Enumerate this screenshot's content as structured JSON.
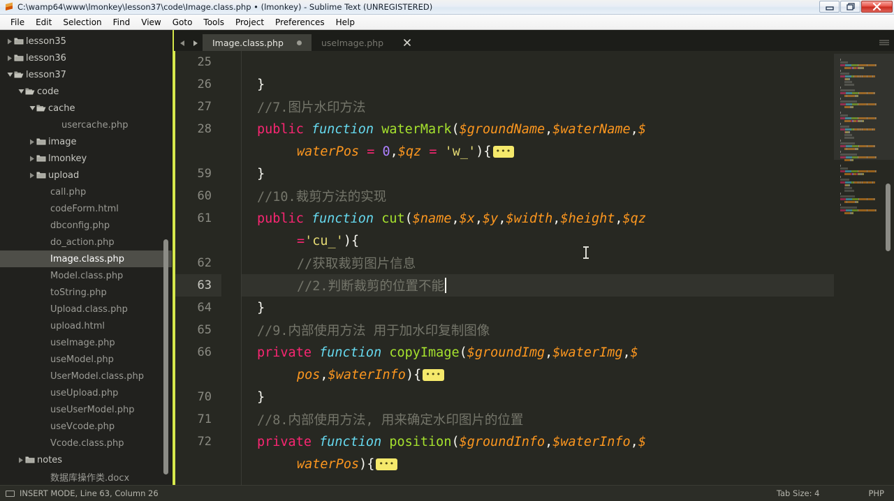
{
  "window": {
    "title": "C:\\wamp64\\www\\lmonkey\\lesson37\\code\\Image.class.php • (lmonkey) - Sublime Text (UNREGISTERED)",
    "icon": "sublime-text-logo-icon",
    "controls": {
      "minimize": "minimize-icon",
      "restore": "restore-icon",
      "close": "close-icon"
    }
  },
  "menubar": {
    "items": [
      {
        "label": "File"
      },
      {
        "label": "Edit"
      },
      {
        "label": "Selection"
      },
      {
        "label": "Find"
      },
      {
        "label": "View"
      },
      {
        "label": "Goto"
      },
      {
        "label": "Tools"
      },
      {
        "label": "Project"
      },
      {
        "label": "Preferences"
      },
      {
        "label": "Help"
      }
    ]
  },
  "sidebar": {
    "items": [
      {
        "label": "lesson35",
        "indent": 1,
        "type": "folder",
        "state": "collapsed",
        "selected": false
      },
      {
        "label": "lesson36",
        "indent": 1,
        "type": "folder",
        "state": "collapsed",
        "selected": false
      },
      {
        "label": "lesson37",
        "indent": 1,
        "type": "folder",
        "state": "expanded",
        "selected": false
      },
      {
        "label": "code",
        "indent": 2,
        "type": "folder",
        "state": "expanded",
        "selected": false
      },
      {
        "label": "cache",
        "indent": 3,
        "type": "folder",
        "state": "expanded",
        "selected": false
      },
      {
        "label": "usercache.php",
        "indent": 5,
        "type": "file",
        "state": "none",
        "selected": false
      },
      {
        "label": "image",
        "indent": 3,
        "type": "folder",
        "state": "collapsed",
        "selected": false
      },
      {
        "label": "lmonkey",
        "indent": 3,
        "type": "folder",
        "state": "collapsed",
        "selected": false
      },
      {
        "label": "upload",
        "indent": 3,
        "type": "folder",
        "state": "collapsed",
        "selected": false
      },
      {
        "label": "call.php",
        "indent": 4,
        "type": "file",
        "state": "none",
        "selected": false
      },
      {
        "label": "codeForm.html",
        "indent": 4,
        "type": "file",
        "state": "none",
        "selected": false
      },
      {
        "label": "dbconfig.php",
        "indent": 4,
        "type": "file",
        "state": "none",
        "selected": false
      },
      {
        "label": "do_action.php",
        "indent": 4,
        "type": "file",
        "state": "none",
        "selected": false
      },
      {
        "label": "Image.class.php",
        "indent": 4,
        "type": "file",
        "state": "none",
        "selected": true
      },
      {
        "label": "Model.class.php",
        "indent": 4,
        "type": "file",
        "state": "none",
        "selected": false
      },
      {
        "label": "toString.php",
        "indent": 4,
        "type": "file",
        "state": "none",
        "selected": false
      },
      {
        "label": "Upload.class.php",
        "indent": 4,
        "type": "file",
        "state": "none",
        "selected": false
      },
      {
        "label": "upload.html",
        "indent": 4,
        "type": "file",
        "state": "none",
        "selected": false
      },
      {
        "label": "useImage.php",
        "indent": 4,
        "type": "file",
        "state": "none",
        "selected": false
      },
      {
        "label": "useModel.php",
        "indent": 4,
        "type": "file",
        "state": "none",
        "selected": false
      },
      {
        "label": "UserModel.class.php",
        "indent": 4,
        "type": "file",
        "state": "none",
        "selected": false
      },
      {
        "label": "useUpload.php",
        "indent": 4,
        "type": "file",
        "state": "none",
        "selected": false
      },
      {
        "label": "useUserModel.php",
        "indent": 4,
        "type": "file",
        "state": "none",
        "selected": false
      },
      {
        "label": "useVcode.php",
        "indent": 4,
        "type": "file",
        "state": "none",
        "selected": false
      },
      {
        "label": "Vcode.class.php",
        "indent": 4,
        "type": "file",
        "state": "none",
        "selected": false
      },
      {
        "label": "notes",
        "indent": 2,
        "type": "folder",
        "state": "collapsed",
        "selected": false
      },
      {
        "label": "数据库操作类.docx",
        "indent": 4,
        "type": "file",
        "state": "none",
        "selected": false
      }
    ]
  },
  "tabs": {
    "nav_prev": "chevron-left-icon",
    "nav_next": "chevron-right-icon",
    "items": [
      {
        "label": "Image.class.php",
        "active": true,
        "dirty": true
      },
      {
        "label": "useImage.php",
        "active": false,
        "dirty": false
      }
    ]
  },
  "editor": {
    "lines": [
      {
        "num": "25",
        "current": false,
        "tokens": []
      },
      {
        "num": "26",
        "current": false,
        "tokens": [
          {
            "t": "plain",
            "s": "}"
          }
        ]
      },
      {
        "num": "27",
        "current": false,
        "tokens": [
          {
            "t": "com",
            "s": "//7.图片水印方法"
          }
        ]
      },
      {
        "num": "28",
        "current": false,
        "tokens": [
          {
            "t": "kw",
            "s": "public "
          },
          {
            "t": "fn",
            "s": "function "
          },
          {
            "t": "name",
            "s": "waterMark"
          },
          {
            "t": "punc",
            "s": "("
          },
          {
            "t": "var",
            "s": "$groundName"
          },
          {
            "t": "punc",
            "s": ","
          },
          {
            "t": "var",
            "s": "$waterName"
          },
          {
            "t": "punc",
            "s": ","
          },
          {
            "t": "var",
            "s": "$"
          }
        ]
      },
      {
        "num": "",
        "current": false,
        "indent": 3,
        "tokens": [
          {
            "t": "var",
            "s": "waterPos "
          },
          {
            "t": "kw",
            "s": "= "
          },
          {
            "t": "num",
            "s": "0"
          },
          {
            "t": "punc",
            "s": ","
          },
          {
            "t": "var",
            "s": "$qz "
          },
          {
            "t": "kw",
            "s": "= "
          },
          {
            "t": "str",
            "s": "'w_'"
          },
          {
            "t": "punc",
            "s": "){"
          },
          {
            "t": "fold",
            "s": "•••"
          }
        ]
      },
      {
        "num": "59",
        "current": false,
        "tokens": [
          {
            "t": "plain",
            "s": "}"
          }
        ]
      },
      {
        "num": "60",
        "current": false,
        "tokens": [
          {
            "t": "com",
            "s": "//10.裁剪方法的实现"
          }
        ]
      },
      {
        "num": "61",
        "current": false,
        "tokens": [
          {
            "t": "kw",
            "s": "public "
          },
          {
            "t": "fn",
            "s": "function "
          },
          {
            "t": "name",
            "s": "cut"
          },
          {
            "t": "punc",
            "s": "("
          },
          {
            "t": "var",
            "s": "$name"
          },
          {
            "t": "punc",
            "s": ","
          },
          {
            "t": "var",
            "s": "$x"
          },
          {
            "t": "punc",
            "s": ","
          },
          {
            "t": "var",
            "s": "$y"
          },
          {
            "t": "punc",
            "s": ","
          },
          {
            "t": "var",
            "s": "$width"
          },
          {
            "t": "punc",
            "s": ","
          },
          {
            "t": "var",
            "s": "$height"
          },
          {
            "t": "punc",
            "s": ","
          },
          {
            "t": "var",
            "s": "$qz"
          }
        ]
      },
      {
        "num": "",
        "current": false,
        "indent": 3,
        "tokens": [
          {
            "t": "kw",
            "s": "="
          },
          {
            "t": "str",
            "s": "'cu_'"
          },
          {
            "t": "punc",
            "s": "){"
          }
        ]
      },
      {
        "num": "62",
        "current": false,
        "indent": 3,
        "tokens": [
          {
            "t": "com",
            "s": "//获取裁剪图片信息"
          }
        ]
      },
      {
        "num": "63",
        "current": true,
        "indent": 3,
        "tokens": [
          {
            "t": "com",
            "s": "//2.判断裁剪的位置不能"
          },
          {
            "t": "caret",
            "s": ""
          }
        ]
      },
      {
        "num": "64",
        "current": false,
        "tokens": [
          {
            "t": "plain",
            "s": "}"
          }
        ]
      },
      {
        "num": "65",
        "current": false,
        "tokens": [
          {
            "t": "com",
            "s": "//9.内部使用方法 用于加水印复制图像"
          }
        ]
      },
      {
        "num": "66",
        "current": false,
        "tokens": [
          {
            "t": "kw",
            "s": "private "
          },
          {
            "t": "fn",
            "s": "function "
          },
          {
            "t": "name",
            "s": "copyImage"
          },
          {
            "t": "punc",
            "s": "("
          },
          {
            "t": "var",
            "s": "$groundImg"
          },
          {
            "t": "punc",
            "s": ","
          },
          {
            "t": "var",
            "s": "$waterImg"
          },
          {
            "t": "punc",
            "s": ","
          },
          {
            "t": "var",
            "s": "$"
          }
        ]
      },
      {
        "num": "",
        "current": false,
        "indent": 3,
        "tokens": [
          {
            "t": "var",
            "s": "pos"
          },
          {
            "t": "punc",
            "s": ","
          },
          {
            "t": "var",
            "s": "$waterInfo"
          },
          {
            "t": "punc",
            "s": "){"
          },
          {
            "t": "fold",
            "s": "•••"
          }
        ]
      },
      {
        "num": "70",
        "current": false,
        "tokens": [
          {
            "t": "plain",
            "s": "}"
          }
        ]
      },
      {
        "num": "71",
        "current": false,
        "tokens": [
          {
            "t": "com",
            "s": "//8.内部使用方法, 用来确定水印图片的位置"
          }
        ]
      },
      {
        "num": "72",
        "current": false,
        "tokens": [
          {
            "t": "kw",
            "s": "private "
          },
          {
            "t": "fn",
            "s": "function "
          },
          {
            "t": "name",
            "s": "position"
          },
          {
            "t": "punc",
            "s": "("
          },
          {
            "t": "var",
            "s": "$groundInfo"
          },
          {
            "t": "punc",
            "s": ","
          },
          {
            "t": "var",
            "s": "$waterInfo"
          },
          {
            "t": "punc",
            "s": ","
          },
          {
            "t": "var",
            "s": "$"
          }
        ]
      },
      {
        "num": "",
        "current": false,
        "indent": 3,
        "tokens": [
          {
            "t": "var",
            "s": "waterPos"
          },
          {
            "t": "punc",
            "s": "){"
          },
          {
            "t": "fold",
            "s": "•••"
          }
        ]
      }
    ]
  },
  "statusbar": {
    "caps_icon": "caps-lock-icon",
    "left": "INSERT MODE, Line 63, Column 26",
    "tab_size": "Tab Size: 4",
    "syntax": "PHP"
  },
  "colors": {
    "accent_divider": "#d6e84c",
    "editor_bg": "#272822",
    "sidebar_bg": "#21211e",
    "selection": "#4e4e48",
    "keyword": "#f92672",
    "function": "#66d9ef",
    "name": "#a6e22e",
    "variable": "#fd971f",
    "comment": "#74756a",
    "string": "#e6db74",
    "number": "#ae81ff"
  }
}
